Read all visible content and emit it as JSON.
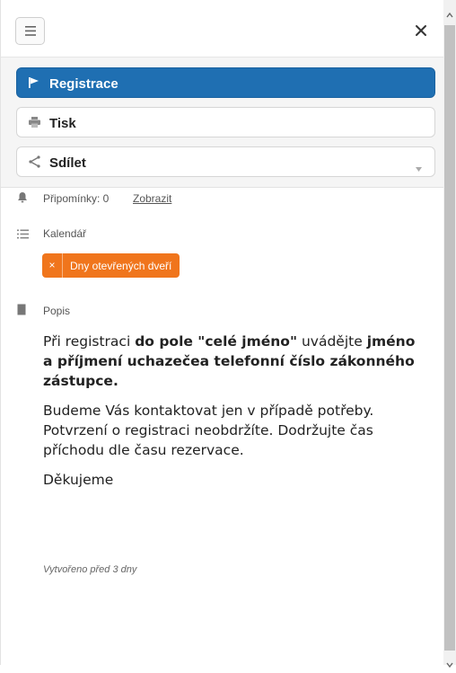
{
  "actions": {
    "register_label": "Registrace",
    "print_label": "Tisk",
    "share_label": "Sdílet"
  },
  "reminders": {
    "label": "Připomínky: 0",
    "show_link": "Zobrazit"
  },
  "calendar": {
    "label": "Kalendář",
    "tag_remove": "×",
    "tag_label": "Dny otevřených dveří"
  },
  "description": {
    "label": "Popis",
    "p1_a": "Při registraci ",
    "p1_b": "do pole \"celé jméno\"",
    "p1_c": " uvádějte ",
    "p1_d": "jméno a příjmení uchazečea telefonní číslo zákonného zástupce.",
    "p2": "Budeme Vás kontaktovat jen v případě potřeby. Potvrzení o registraci neobdržíte. Dodržujte čas příchodu dle času rezervace.",
    "p3": "Děkujeme"
  },
  "footer": {
    "created": "Vytvořeno před 3 dny"
  },
  "colors": {
    "primary": "#1f6fb2",
    "tag": "#f0751c"
  },
  "icons": {
    "menu": "hamburger-icon",
    "close": "close-icon",
    "register": "flag-icon",
    "print": "printer-icon",
    "share": "share-icon",
    "reminders": "bell-icon",
    "calendar": "list-icon",
    "description": "document-icon"
  }
}
